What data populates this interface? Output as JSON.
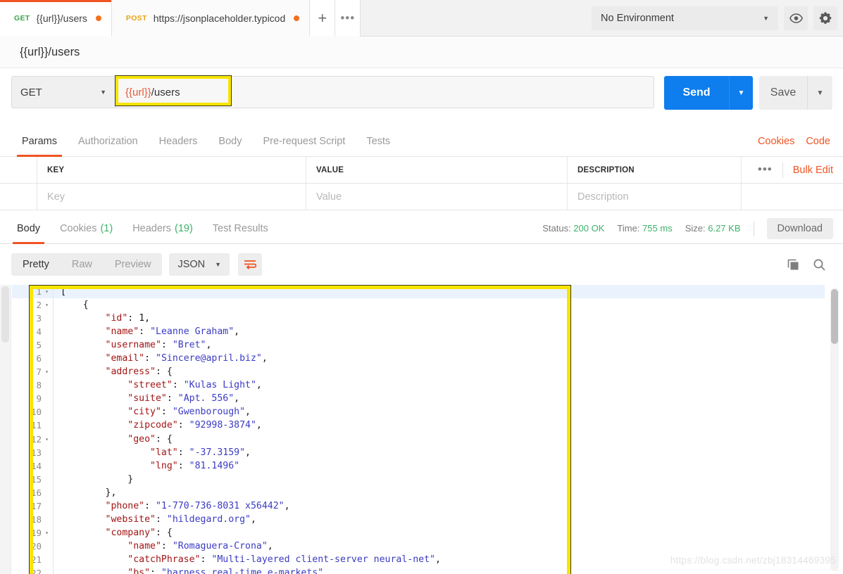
{
  "topbar": {
    "tabs": [
      {
        "method": "GET",
        "method_class": "m-get",
        "name": "{{url}}/users",
        "active": true,
        "unsaved": true
      },
      {
        "method": "POST",
        "method_class": "m-post",
        "name": "https://jsonplaceholder.typicod",
        "active": false,
        "unsaved": true
      }
    ],
    "new_tab_label": "+",
    "tab_options_label": "•••",
    "environment": {
      "selected": "No Environment",
      "caret": "▼"
    },
    "eye_icon": "eye-icon",
    "gear_icon": "gear-icon"
  },
  "request": {
    "name": "{{url}}/users",
    "method": "GET",
    "method_caret": "▼",
    "url_variable": "{{url}}",
    "url_path": "/users",
    "send_label": "Send",
    "send_caret": "▼",
    "save_label": "Save",
    "save_caret": "▼",
    "tabs": [
      {
        "label": "Params",
        "active": true
      },
      {
        "label": "Authorization",
        "active": false
      },
      {
        "label": "Headers",
        "active": false
      },
      {
        "label": "Body",
        "active": false
      },
      {
        "label": "Pre-request Script",
        "active": false
      },
      {
        "label": "Tests",
        "active": false
      }
    ],
    "cookies_link": "Cookies",
    "code_link": "Code"
  },
  "params": {
    "columns": [
      "KEY",
      "VALUE",
      "DESCRIPTION"
    ],
    "options_label": "•••",
    "bulk_edit_label": "Bulk Edit",
    "empty_row": {
      "key_placeholder": "Key",
      "value_placeholder": "Value",
      "description_placeholder": "Description"
    }
  },
  "response": {
    "tabs": [
      {
        "label": "Body",
        "count": "",
        "active": true
      },
      {
        "label": "Cookies",
        "count": "(1)",
        "active": false
      },
      {
        "label": "Headers",
        "count": "(19)",
        "active": false
      },
      {
        "label": "Test Results",
        "count": "",
        "active": false
      }
    ],
    "status_label": "Status:",
    "status_value": "200 OK",
    "time_label": "Time:",
    "time_value": "755 ms",
    "size_label": "Size:",
    "size_value": "6.27 KB",
    "download_label": "Download",
    "view_modes": [
      {
        "label": "Pretty",
        "active": true
      },
      {
        "label": "Raw",
        "active": false
      },
      {
        "label": "Preview",
        "active": false
      }
    ],
    "format": "JSON",
    "format_caret": "▼",
    "wrap_icon": "word-wrap-icon",
    "copy_icon": "copy-icon",
    "search_icon": "search-icon"
  },
  "json_viewer": {
    "lines": [
      {
        "n": "1",
        "fold": "▾",
        "indent": 0,
        "tokens": [
          {
            "t": "[",
            "c": "jp"
          }
        ]
      },
      {
        "n": "2",
        "fold": "▾",
        "indent": 1,
        "tokens": [
          {
            "t": "{",
            "c": "jp"
          }
        ]
      },
      {
        "n": "3",
        "fold": "",
        "indent": 2,
        "tokens": [
          {
            "t": "\"id\"",
            "c": "jk"
          },
          {
            "t": ": ",
            "c": "jp"
          },
          {
            "t": "1",
            "c": "jn"
          },
          {
            "t": ",",
            "c": "jp"
          }
        ]
      },
      {
        "n": "4",
        "fold": "",
        "indent": 2,
        "tokens": [
          {
            "t": "\"name\"",
            "c": "jk"
          },
          {
            "t": ": ",
            "c": "jp"
          },
          {
            "t": "\"Leanne Graham\"",
            "c": "js"
          },
          {
            "t": ",",
            "c": "jp"
          }
        ]
      },
      {
        "n": "5",
        "fold": "",
        "indent": 2,
        "tokens": [
          {
            "t": "\"username\"",
            "c": "jk"
          },
          {
            "t": ": ",
            "c": "jp"
          },
          {
            "t": "\"Bret\"",
            "c": "js"
          },
          {
            "t": ",",
            "c": "jp"
          }
        ]
      },
      {
        "n": "6",
        "fold": "",
        "indent": 2,
        "tokens": [
          {
            "t": "\"email\"",
            "c": "jk"
          },
          {
            "t": ": ",
            "c": "jp"
          },
          {
            "t": "\"Sincere@april.biz\"",
            "c": "js"
          },
          {
            "t": ",",
            "c": "jp"
          }
        ]
      },
      {
        "n": "7",
        "fold": "▾",
        "indent": 2,
        "tokens": [
          {
            "t": "\"address\"",
            "c": "jk"
          },
          {
            "t": ": {",
            "c": "jp"
          }
        ]
      },
      {
        "n": "8",
        "fold": "",
        "indent": 3,
        "tokens": [
          {
            "t": "\"street\"",
            "c": "jk"
          },
          {
            "t": ": ",
            "c": "jp"
          },
          {
            "t": "\"Kulas Light\"",
            "c": "js"
          },
          {
            "t": ",",
            "c": "jp"
          }
        ]
      },
      {
        "n": "9",
        "fold": "",
        "indent": 3,
        "tokens": [
          {
            "t": "\"suite\"",
            "c": "jk"
          },
          {
            "t": ": ",
            "c": "jp"
          },
          {
            "t": "\"Apt. 556\"",
            "c": "js"
          },
          {
            "t": ",",
            "c": "jp"
          }
        ]
      },
      {
        "n": "10",
        "fold": "",
        "indent": 3,
        "tokens": [
          {
            "t": "\"city\"",
            "c": "jk"
          },
          {
            "t": ": ",
            "c": "jp"
          },
          {
            "t": "\"Gwenborough\"",
            "c": "js"
          },
          {
            "t": ",",
            "c": "jp"
          }
        ]
      },
      {
        "n": "11",
        "fold": "",
        "indent": 3,
        "tokens": [
          {
            "t": "\"zipcode\"",
            "c": "jk"
          },
          {
            "t": ": ",
            "c": "jp"
          },
          {
            "t": "\"92998-3874\"",
            "c": "js"
          },
          {
            "t": ",",
            "c": "jp"
          }
        ]
      },
      {
        "n": "12",
        "fold": "▾",
        "indent": 3,
        "tokens": [
          {
            "t": "\"geo\"",
            "c": "jk"
          },
          {
            "t": ": {",
            "c": "jp"
          }
        ]
      },
      {
        "n": "13",
        "fold": "",
        "indent": 4,
        "tokens": [
          {
            "t": "\"lat\"",
            "c": "jk"
          },
          {
            "t": ": ",
            "c": "jp"
          },
          {
            "t": "\"-37.3159\"",
            "c": "js"
          },
          {
            "t": ",",
            "c": "jp"
          }
        ]
      },
      {
        "n": "14",
        "fold": "",
        "indent": 4,
        "tokens": [
          {
            "t": "\"lng\"",
            "c": "jk"
          },
          {
            "t": ": ",
            "c": "jp"
          },
          {
            "t": "\"81.1496\"",
            "c": "js"
          }
        ]
      },
      {
        "n": "15",
        "fold": "",
        "indent": 3,
        "tokens": [
          {
            "t": "}",
            "c": "jp"
          }
        ]
      },
      {
        "n": "16",
        "fold": "",
        "indent": 2,
        "tokens": [
          {
            "t": "},",
            "c": "jp"
          }
        ]
      },
      {
        "n": "17",
        "fold": "",
        "indent": 2,
        "tokens": [
          {
            "t": "\"phone\"",
            "c": "jk"
          },
          {
            "t": ": ",
            "c": "jp"
          },
          {
            "t": "\"1-770-736-8031 x56442\"",
            "c": "js"
          },
          {
            "t": ",",
            "c": "jp"
          }
        ]
      },
      {
        "n": "18",
        "fold": "",
        "indent": 2,
        "tokens": [
          {
            "t": "\"website\"",
            "c": "jk"
          },
          {
            "t": ": ",
            "c": "jp"
          },
          {
            "t": "\"hildegard.org\"",
            "c": "js"
          },
          {
            "t": ",",
            "c": "jp"
          }
        ]
      },
      {
        "n": "19",
        "fold": "▾",
        "indent": 2,
        "tokens": [
          {
            "t": "\"company\"",
            "c": "jk"
          },
          {
            "t": ": {",
            "c": "jp"
          }
        ]
      },
      {
        "n": "20",
        "fold": "",
        "indent": 3,
        "tokens": [
          {
            "t": "\"name\"",
            "c": "jk"
          },
          {
            "t": ": ",
            "c": "jp"
          },
          {
            "t": "\"Romaguera-Crona\"",
            "c": "js"
          },
          {
            "t": ",",
            "c": "jp"
          }
        ]
      },
      {
        "n": "21",
        "fold": "",
        "indent": 3,
        "tokens": [
          {
            "t": "\"catchPhrase\"",
            "c": "jk"
          },
          {
            "t": ": ",
            "c": "jp"
          },
          {
            "t": "\"Multi-layered client-server neural-net\"",
            "c": "js"
          },
          {
            "t": ",",
            "c": "jp"
          }
        ]
      },
      {
        "n": "22",
        "fold": "",
        "indent": 3,
        "tokens": [
          {
            "t": "\"bs\"",
            "c": "jk"
          },
          {
            "t": ": ",
            "c": "jp"
          },
          {
            "t": "\"harness real-time e-markets\"",
            "c": "js"
          }
        ]
      }
    ]
  },
  "watermark": "https://blog.csdn.net/zbj18314469395"
}
